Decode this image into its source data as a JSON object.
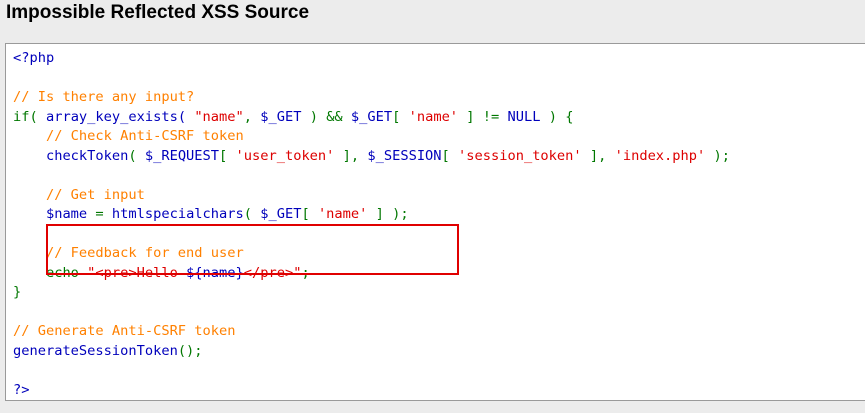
{
  "title": "Impossible Reflected XSS Source",
  "colors": {
    "default": "#0000bb",
    "keyword": "#007700",
    "comment": "#ff8000",
    "string": "#dd0000",
    "highlight_border": "#e00000"
  },
  "code": {
    "l01": "<?php",
    "l02": "",
    "l03": "// Is there any input?",
    "l04": {
      "a": "if(",
      "b": " array_key_exists(",
      "c": " \"name\"",
      "d": ",",
      "e": " $_GET",
      "f": " ) && ",
      "g": "$_GET",
      "h": "[ ",
      "i": "'name'",
      "j": " ] != ",
      "k": "NULL",
      "l": " ) {"
    },
    "l05": "    // Check Anti-CSRF token",
    "l06": {
      "a": "    checkToken",
      "b": "( ",
      "c": "$_REQUEST",
      "d": "[ ",
      "e": "'user_token'",
      "f": " ], ",
      "g": "$_SESSION",
      "h": "[ ",
      "i": "'session_token'",
      "j": " ], ",
      "k": "'index.php'",
      "l": " );"
    },
    "l07": "",
    "l08": "    // Get input",
    "l09": {
      "a": "    $name",
      "b": " = ",
      "c": "htmlspecialchars",
      "d": "( ",
      "e": "$_GET",
      "f": "[ ",
      "g": "'name'",
      "h": " ] );"
    },
    "l10": "",
    "l11": "    // Feedback for end user",
    "l12": {
      "a": "    echo ",
      "b": "\"<pre>Hello ",
      "c": "${name}",
      "d": "</pre>\"",
      "e": ";"
    },
    "l13": "}",
    "l14": "",
    "l15": "// Generate Anti-CSRF token",
    "l16": {
      "a": "generateSessionToken",
      "b": "();"
    },
    "l17": "",
    "l18": "?>"
  }
}
